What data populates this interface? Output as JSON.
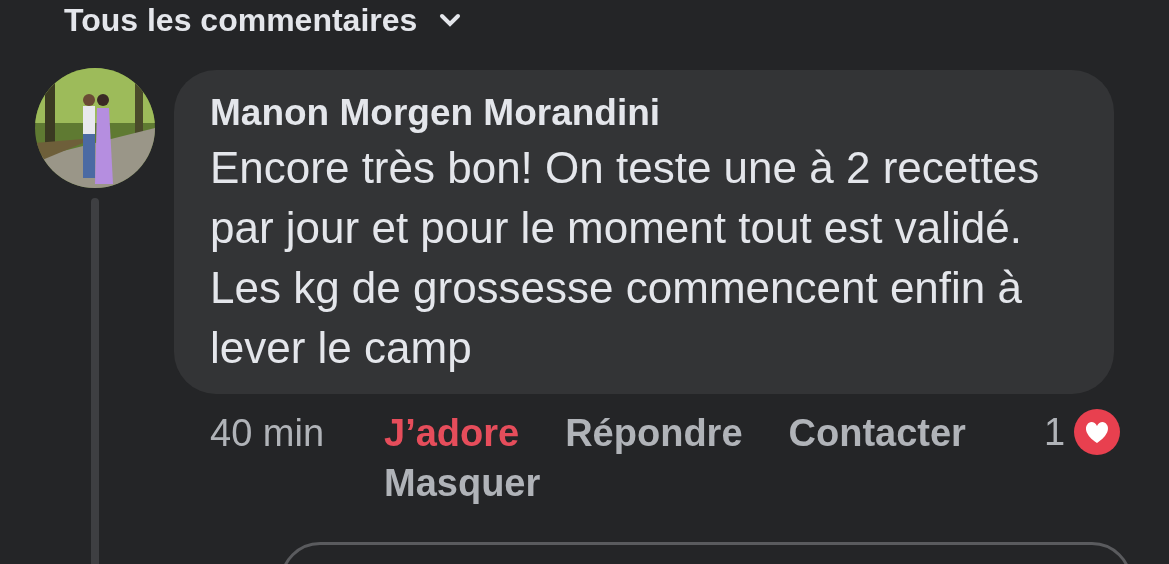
{
  "header": {
    "title": "Tous les commentaires"
  },
  "comment": {
    "author": "Manon Morgen Morandini",
    "text": "Encore très bon! On teste une à 2 recettes par jour et pour le moment tout est validé. Les kg de grossesse commencent enfin à lever le camp",
    "time": "40 min",
    "liked": true,
    "actions": [
      {
        "kind": "like",
        "label": "J’adore"
      },
      {
        "kind": "reply",
        "label": "Répondre"
      },
      {
        "kind": "contact",
        "label": "Contacter"
      },
      {
        "kind": "hide",
        "label": "Masquer"
      }
    ],
    "reaction_count": "1"
  }
}
